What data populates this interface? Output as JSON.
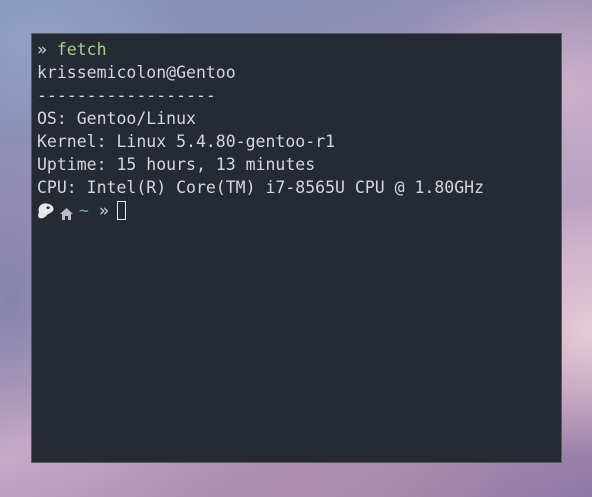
{
  "terminal": {
    "command_line": {
      "prompt_symbol": "»",
      "command": "fetch"
    },
    "output": [
      "krissemicolon@Gentoo",
      "------------------",
      "OS: Gentoo/Linux",
      "Kernel: Linux 5.4.80-gentoo-r1",
      "Uptime: 15 hours, 13 minutes",
      "CPU: Intel(R) Core(TM) i7-8565U CPU @ 1.80GHz"
    ],
    "prompt": {
      "os_icon": "gentoo-logo-icon",
      "home_icon": "home-icon",
      "directory": "~",
      "symbol": "»"
    }
  },
  "colors": {
    "terminal_background": "#262a33",
    "text": "#d3d6dc",
    "command": "#a8cf8e",
    "directory": "#7a9fc9"
  }
}
